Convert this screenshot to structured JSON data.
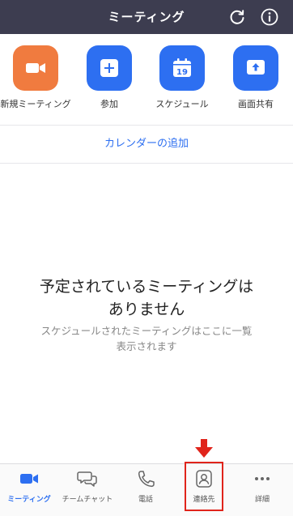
{
  "header": {
    "title": "ミーティング"
  },
  "actions": [
    {
      "label": "新規ミーティング",
      "icon": "video-camera-icon",
      "color": "#f07b3f"
    },
    {
      "label": "参加",
      "icon": "plus-icon",
      "color": "#2d6ff1"
    },
    {
      "label": "スケジュール",
      "icon": "calendar-icon",
      "color": "#2d6ff1",
      "date": "19"
    },
    {
      "label": "画面共有",
      "icon": "share-screen-icon",
      "color": "#2d6ff1"
    }
  ],
  "calendar_link": "カレンダーの追加",
  "empty_state": {
    "title_line1": "予定されているミーティングは",
    "title_line2": "ありません",
    "subtitle_line1": "スケジュールされたミーティングはここに一覧",
    "subtitle_line2": "表示されます"
  },
  "tabs": [
    {
      "label": "ミーティング",
      "icon": "video-camera-icon",
      "active": true
    },
    {
      "label": "チームチャット",
      "icon": "chat-bubbles-icon",
      "active": false
    },
    {
      "label": "電話",
      "icon": "phone-icon",
      "active": false
    },
    {
      "label": "連絡先",
      "icon": "contact-icon",
      "active": false
    },
    {
      "label": "詳細",
      "icon": "more-dots-icon",
      "active": false
    }
  ],
  "colors": {
    "header_bg": "#3d3d50",
    "accent": "#2d6ff1",
    "orange": "#f07b3f",
    "highlight": "#e0241b"
  }
}
